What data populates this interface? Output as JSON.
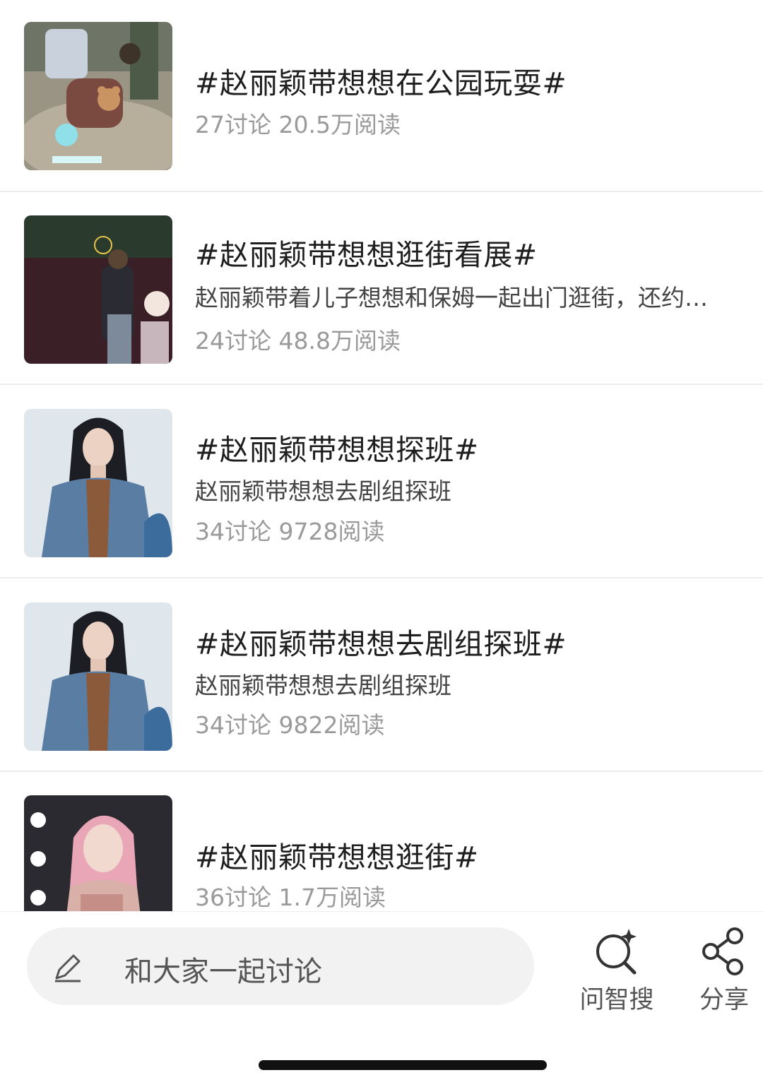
{
  "topics": [
    {
      "title": "#赵丽颖带想想在公园玩耍#",
      "stats": "27讨论 20.5万阅读"
    },
    {
      "title": "#赵丽颖带想想逛街看展#",
      "desc": "赵丽颖带着儿子想想和保姆一起出门逛街，还约…",
      "stats": "24讨论 48.8万阅读"
    },
    {
      "title": "#赵丽颖带想想探班#",
      "desc": "赵丽颖带想想去剧组探班",
      "stats": "34讨论 9728阅读"
    },
    {
      "title": "#赵丽颖带想想去剧组探班#",
      "desc": "赵丽颖带想想去剧组探班",
      "stats": "34讨论 9822阅读"
    },
    {
      "title": "#赵丽颖带想想逛街#",
      "stats": "36讨论 1.7万阅读"
    }
  ],
  "bottom_bar": {
    "compose_placeholder": "和大家一起讨论",
    "compose_icon": "pencil-icon",
    "search_label": "问智搜",
    "search_icon": "sparkle-search-icon",
    "share_label": "分享",
    "share_icon": "share-icon"
  }
}
